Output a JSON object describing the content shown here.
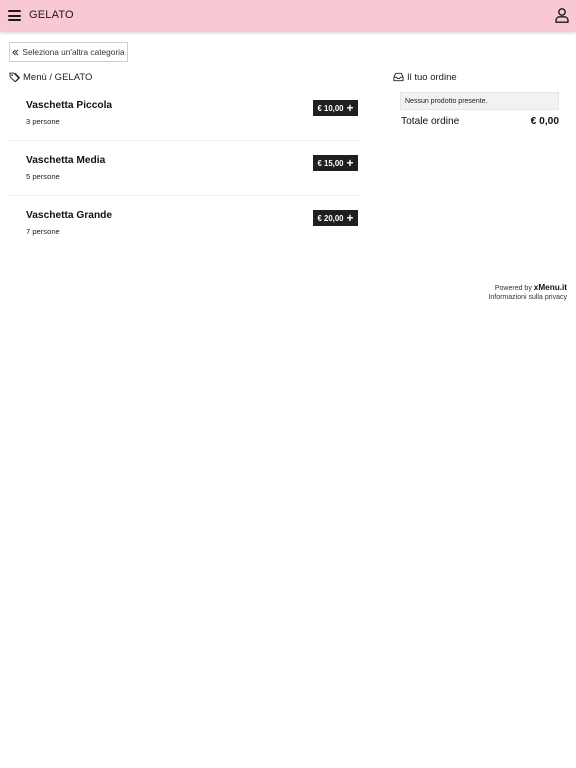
{
  "header": {
    "title": "GELATO",
    "menu_icon": "hamburger-icon",
    "user_icon": "user-icon",
    "background_color": "#f8c8d4"
  },
  "back_button": {
    "label": "Seleziona un'altra categoria",
    "icon": "double-chevron-left-icon"
  },
  "menu_breadcrumb": {
    "label": "Menù / GELATO",
    "icon": "tags-icon"
  },
  "products": [
    {
      "name": "Vaschetta Piccola",
      "subtitle": "3 persone",
      "price": "€ 10,00"
    },
    {
      "name": "Vaschetta Media",
      "subtitle": "5 persone",
      "price": "€ 15,00"
    },
    {
      "name": "Vaschetta Grande",
      "subtitle": "7 persone",
      "price": "€ 20,00"
    }
  ],
  "order": {
    "title": "Il tuo ordine",
    "icon": "inbox-icon",
    "empty_message": "Nessun prodotto presente.",
    "total_label": "Totale ordine",
    "total_value": "€ 0,00"
  },
  "footer": {
    "powered_by": "Powered by",
    "brand": "xMenu.it",
    "privacy_link": "Informazioni sulla privacy"
  }
}
